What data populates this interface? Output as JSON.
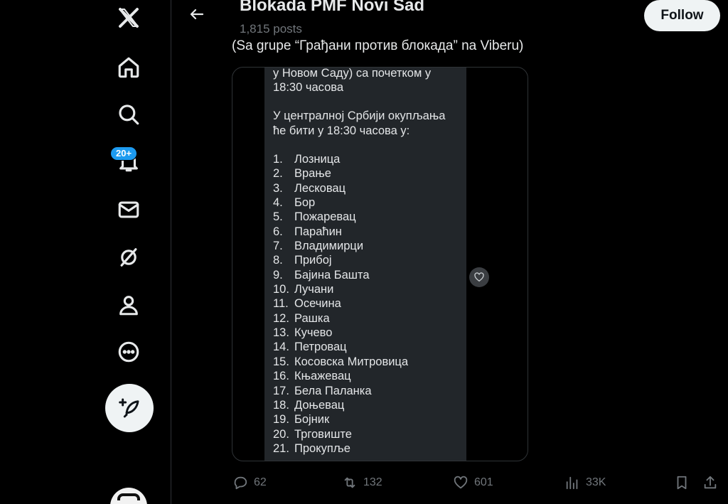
{
  "header": {
    "title": "Blokada PMF Novi Sad",
    "post_count": "1,815 posts",
    "follow_label": "Follow"
  },
  "sidebar": {
    "notification_badge": "20+",
    "icons": [
      "x-logo-icon",
      "home-icon",
      "search-icon",
      "bell-icon",
      "mail-icon",
      "grok-icon",
      "profile-icon",
      "more-icon",
      "compose-icon"
    ]
  },
  "tweet": {
    "text": "(Sa grupe “Грађани против блокада” na Viberu)"
  },
  "media": {
    "intro_line1": "у Новом Саду) са почетком у",
    "intro_line2": "18:30 часова",
    "central_line1": "У централној Србији окупљања",
    "central_line2": "ће бити у 18:30 часова у:",
    "cities": [
      {
        "num": "1.",
        "name": "Лозница"
      },
      {
        "num": "2.",
        "name": "Врање"
      },
      {
        "num": "3.",
        "name": "Лесковац"
      },
      {
        "num": "4.",
        "name": "Бор"
      },
      {
        "num": "5.",
        "name": "Пожаревац"
      },
      {
        "num": "6.",
        "name": "Параћин"
      },
      {
        "num": "7.",
        "name": "Владимирци"
      },
      {
        "num": "8.",
        "name": "Прибој"
      },
      {
        "num": "9.",
        "name": "Бајина Башта"
      },
      {
        "num": "10.",
        "name": "Лучани"
      },
      {
        "num": "11.",
        "name": "Осечина"
      },
      {
        "num": "12.",
        "name": "Рашка"
      },
      {
        "num": "13.",
        "name": "Кучево"
      },
      {
        "num": "14.",
        "name": "Петровац"
      },
      {
        "num": "15.",
        "name": "Косовска Митровица"
      },
      {
        "num": "16.",
        "name": "Књажевац"
      },
      {
        "num": "17.",
        "name": "Бела Паланка"
      },
      {
        "num": "18.",
        "name": "Доњевац"
      },
      {
        "num": "19.",
        "name": "Бојник"
      },
      {
        "num": "20.",
        "name": "Трговиште"
      },
      {
        "num": "21.",
        "name": "Прокупље"
      }
    ]
  },
  "actions": {
    "replies": "62",
    "retweets": "132",
    "likes": "601",
    "views": "33K"
  },
  "colors": {
    "background": "#000000",
    "accent": "#1d9bf0",
    "muted": "#71767b",
    "text": "#e7e9ea"
  }
}
